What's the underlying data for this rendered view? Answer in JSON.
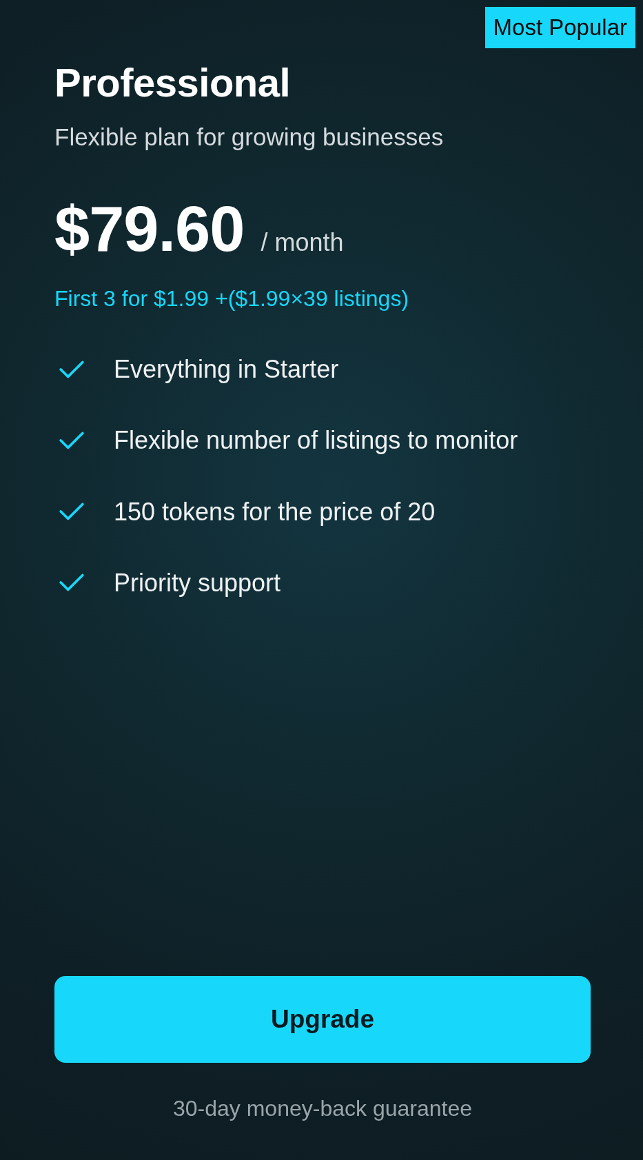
{
  "badge": "Most Popular",
  "plan": {
    "title": "Professional",
    "subtitle": "Flexible plan for growing businesses",
    "price": "$79.60",
    "period": "/ month",
    "promo": "First 3 for $1.99 +($1.99×39 listings)"
  },
  "features": [
    "Everything in Starter",
    "Flexible number of listings to monitor",
    "150 tokens for the price of 20",
    "Priority support"
  ],
  "button": {
    "label": "Upgrade"
  },
  "guarantee": "30-day money-back guarantee"
}
